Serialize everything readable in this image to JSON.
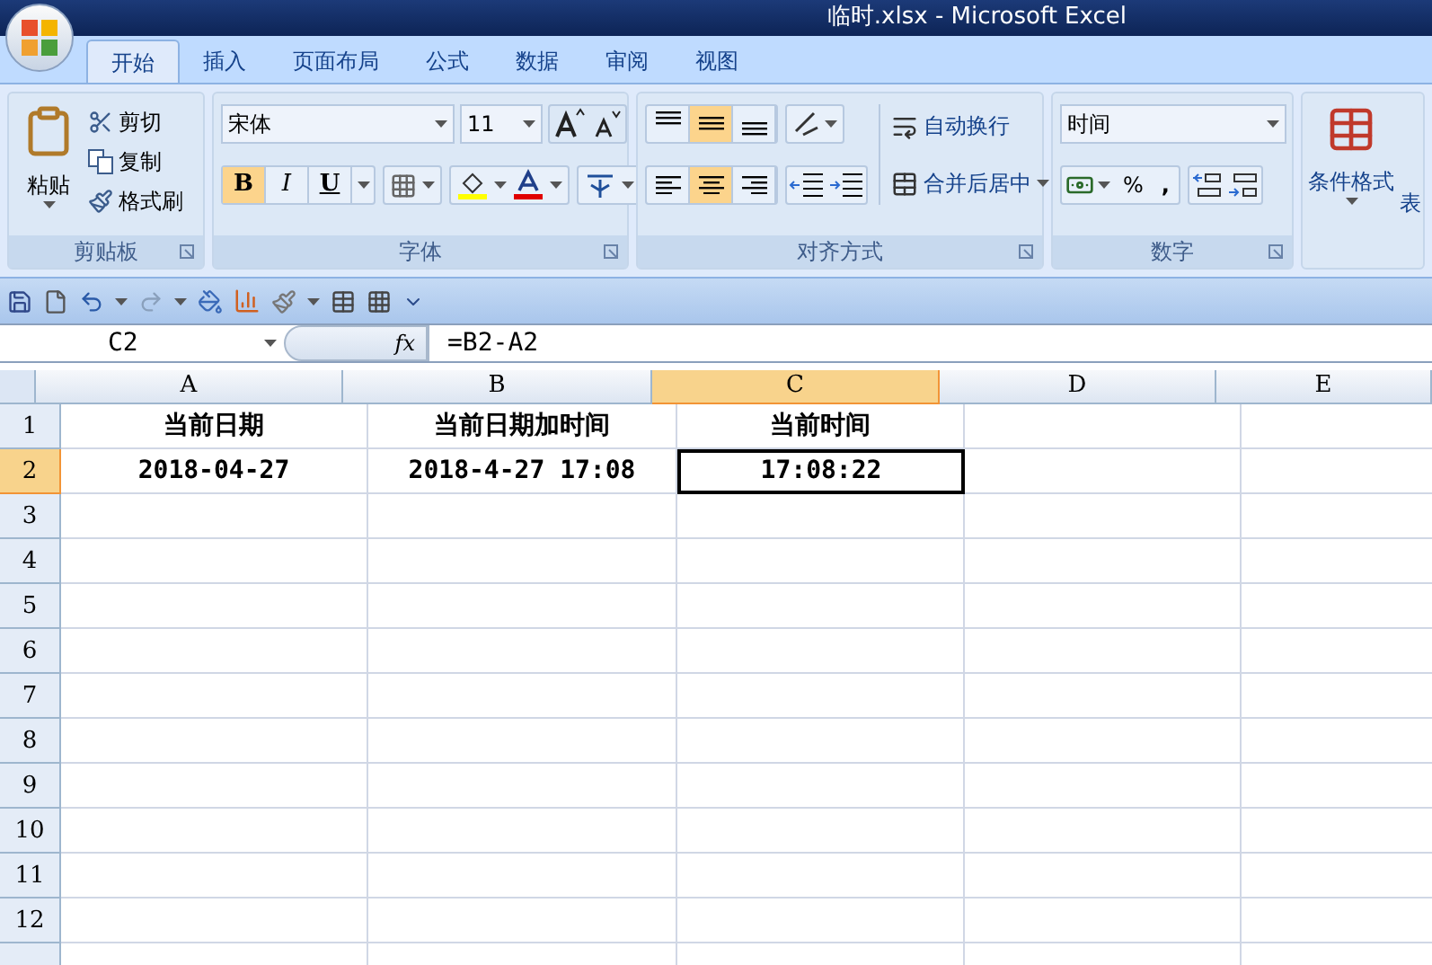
{
  "window": {
    "title": "临时.xlsx - Microsoft Excel"
  },
  "tabs": [
    {
      "label": "开始",
      "selected": true
    },
    {
      "label": "插入",
      "selected": false
    },
    {
      "label": "页面布局",
      "selected": false
    },
    {
      "label": "公式",
      "selected": false
    },
    {
      "label": "数据",
      "selected": false
    },
    {
      "label": "审阅",
      "selected": false
    },
    {
      "label": "视图",
      "selected": false
    }
  ],
  "ribbon": {
    "clipboard": {
      "label": "剪贴板",
      "paste": "粘贴",
      "cut": "剪切",
      "copy": "复制",
      "format_painter": "格式刷"
    },
    "font": {
      "label": "字体",
      "font_name": "宋体",
      "font_size": "11",
      "styles": [
        {
          "kind": "bold",
          "label": "B",
          "on": true
        },
        {
          "kind": "italic",
          "label": "I",
          "on": false
        },
        {
          "kind": "underline",
          "label": "U",
          "on": false
        }
      ]
    },
    "alignment": {
      "label": "对齐方式",
      "vertical": [
        {
          "kind": "top",
          "selected": false
        },
        {
          "kind": "middle",
          "selected": true
        },
        {
          "kind": "bottom",
          "selected": false
        }
      ],
      "horizontal": [
        {
          "kind": "left",
          "selected": false
        },
        {
          "kind": "center",
          "selected": true
        },
        {
          "kind": "right",
          "selected": false
        }
      ],
      "wrap_text": "自动换行",
      "merge_center": "合并后居中"
    },
    "number": {
      "label": "数字",
      "format": "时间",
      "percent": "%",
      "comma": ","
    },
    "styles": {
      "conditional_formatting": "条件格式",
      "table_format": "表"
    }
  },
  "formula_bar": {
    "name_box": "C2",
    "fx": "fx",
    "formula": "=B2-A2"
  },
  "sheet": {
    "columns": [
      {
        "label": "A",
        "selected": false
      },
      {
        "label": "B",
        "selected": false
      },
      {
        "label": "C",
        "selected": true
      },
      {
        "label": "D",
        "selected": false
      },
      {
        "label": "E",
        "selected": false
      }
    ],
    "rows": [
      {
        "label": "1",
        "selected": false,
        "cells": [
          {
            "text": "当前日期",
            "selected": false
          },
          {
            "text": "当前日期加时间",
            "selected": false
          },
          {
            "text": "当前时间",
            "selected": false
          }
        ]
      },
      {
        "label": "2",
        "selected": true,
        "cells": [
          {
            "text": "2018-04-27",
            "selected": false
          },
          {
            "text": "2018-4-27 17:08",
            "selected": false
          },
          {
            "text": "17:08:22",
            "selected": true
          }
        ]
      },
      {
        "label": "3",
        "selected": false
      },
      {
        "label": "4",
        "selected": false
      },
      {
        "label": "5",
        "selected": false
      },
      {
        "label": "6",
        "selected": false
      },
      {
        "label": "7",
        "selected": false
      },
      {
        "label": "8",
        "selected": false
      },
      {
        "label": "9",
        "selected": false
      },
      {
        "label": "10",
        "selected": false
      },
      {
        "label": "11",
        "selected": false
      },
      {
        "label": "12",
        "selected": false
      }
    ]
  }
}
